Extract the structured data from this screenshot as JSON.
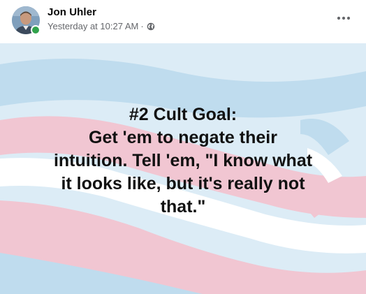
{
  "post": {
    "author": "Jon Uhler",
    "timestamp": "Yesterday at 10:27 AM",
    "separator": "·",
    "privacy_icon": "globe-icon",
    "more_icon": "more-horizontal-icon",
    "presence_color": "#31a24c"
  },
  "image": {
    "lines": [
      "#2 Cult Goal:",
      "Get 'em to negate their",
      "intuition. Tell 'em, \"I know what",
      "it looks like, but it's really not",
      "that.\""
    ],
    "colors": {
      "blue": "#bfdcee",
      "pink": "#f1c6d2",
      "white": "#ffffff",
      "background": "#dcecf6"
    }
  }
}
